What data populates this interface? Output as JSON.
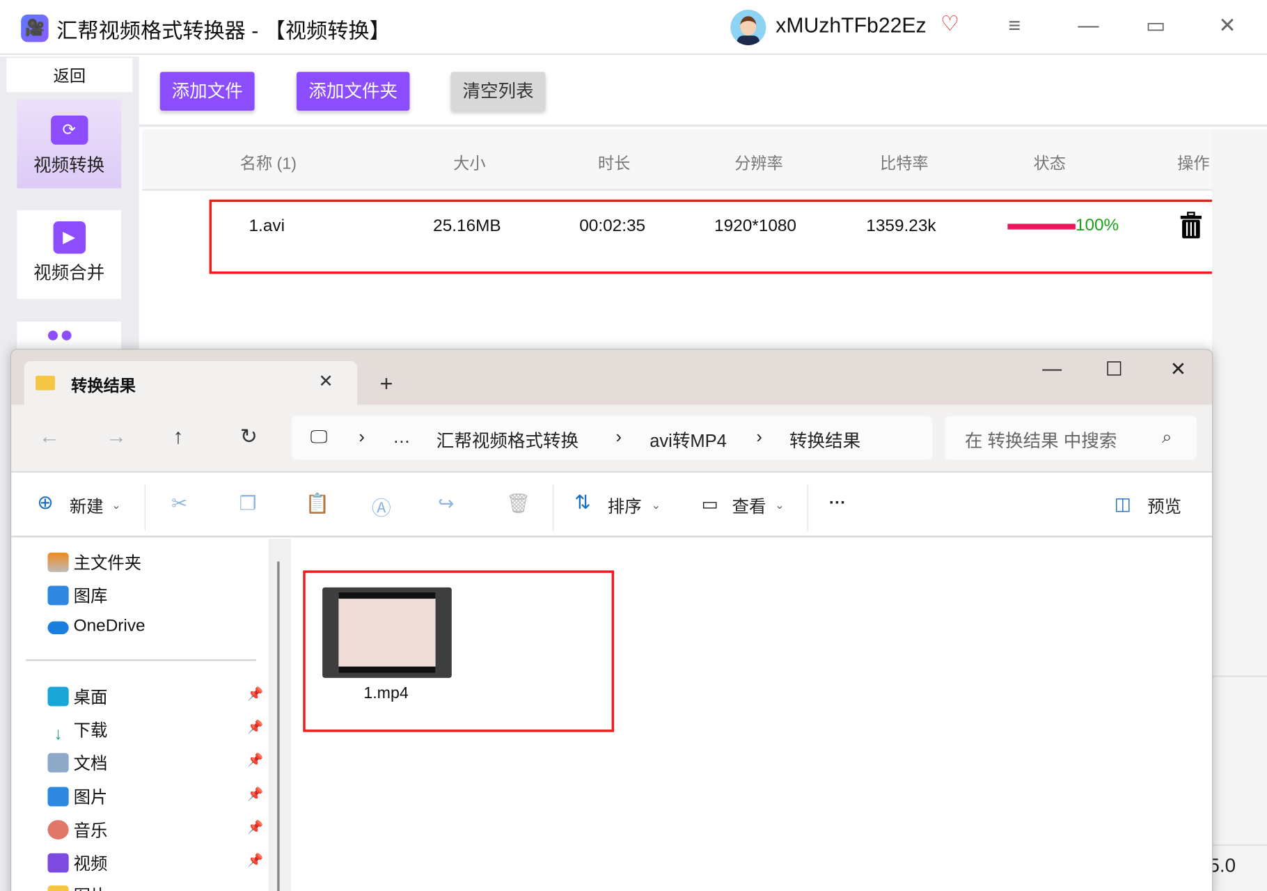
{
  "app": {
    "title": "汇帮视频格式转换器  - 【视频转换】",
    "username": "xMUzhTFb22Ez",
    "version": "5.0"
  },
  "window_controls": {
    "menu": "≡",
    "minimize": "—",
    "maximize": "▭",
    "close": "✕"
  },
  "sidebar": {
    "back": "返回",
    "items": [
      {
        "label": "视频转换",
        "active": true
      },
      {
        "label": "视频合并",
        "active": false
      }
    ]
  },
  "toolbar": {
    "add_file": "添加文件",
    "add_folder": "添加文件夹",
    "clear_list": "清空列表"
  },
  "table": {
    "headers": [
      "名称 (1)",
      "大小",
      "时长",
      "分辨率",
      "比特率",
      "状态",
      "操作"
    ],
    "rows": [
      {
        "name": "1.avi",
        "size": "25.16MB",
        "duration": "00:02:35",
        "resolution": "1920*1080",
        "bitrate": "1359.23k",
        "progress": 100,
        "progress_label": "100%"
      }
    ]
  },
  "explorer": {
    "tab_title": "转换结果",
    "new_tab": "+",
    "close_tab": "✕",
    "controls": {
      "minimize": "—",
      "maximize": "☐",
      "close": "✕"
    },
    "breadcrumb": [
      "…",
      "汇帮视频格式转换",
      "avi转MP4",
      "转换结果"
    ],
    "search_placeholder": "在 转换结果 中搜索",
    "toolbar": {
      "new": "新建",
      "sort": "排序",
      "view": "查看",
      "more": "···",
      "preview": "预览"
    },
    "nav": {
      "top": [
        "主文件夹",
        "图库",
        "OneDrive"
      ],
      "pinned": [
        "桌面",
        "下载",
        "文档",
        "图片",
        "音乐",
        "视频",
        "图片"
      ]
    },
    "files": [
      {
        "name": "1.mp4"
      }
    ]
  }
}
